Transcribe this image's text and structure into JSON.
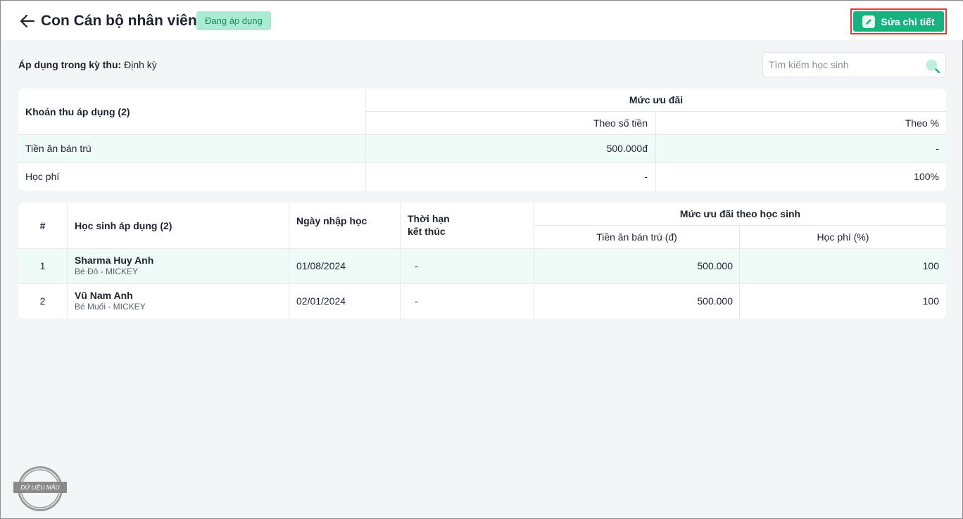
{
  "header": {
    "title": "Con Cán bộ nhân viên",
    "status": "Đang áp dụng",
    "edit_label": "Sửa chi tiết"
  },
  "apply": {
    "label": "Áp dụng trong kỳ thu:",
    "value": "Định kỳ"
  },
  "search": {
    "placeholder": "Tìm kiếm học sinh"
  },
  "fees_table": {
    "col_fee": "Khoản thu áp dụng (2)",
    "col_group": "Mức ưu đãi",
    "col_amount": "Theo số tiền",
    "col_percent": "Theo %",
    "rows": [
      {
        "name": "Tiền ăn bán trú",
        "amount": "500.000đ",
        "percent": "-"
      },
      {
        "name": "Học phí",
        "amount": "-",
        "percent": "100%"
      }
    ]
  },
  "students_table": {
    "col_index": "#",
    "col_student": "Học sinh áp dụng (2)",
    "col_enroll": "Ngày nhập học",
    "col_end_1": "Thời hạn",
    "col_end_2": "kết thúc",
    "col_group": "Mức ưu đãi theo học sinh",
    "col_meal": "Tiền ăn bán trú (đ)",
    "col_tuition": "Học phí (%)",
    "rows": [
      {
        "index": "1",
        "name": "Sharma Huy Anh",
        "sub": "Bé Đô - MICKEY",
        "enroll": "01/08/2024",
        "end": "-",
        "meal": "500.000",
        "tuition": "100"
      },
      {
        "index": "2",
        "name": "Vũ Nam Anh",
        "sub": "Bé Muối - MICKEY",
        "enroll": "02/01/2024",
        "end": "-",
        "meal": "500.000",
        "tuition": "100"
      }
    ]
  },
  "watermark": {
    "text": "DỮ LIỆU MẪU"
  },
  "colors": {
    "accent": "#17b27f",
    "badge_bg": "#a9ebd3",
    "highlight_row": "#effbf6",
    "outline": "#e53935"
  }
}
